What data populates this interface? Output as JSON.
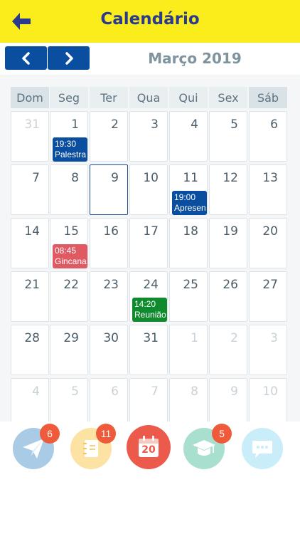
{
  "header": {
    "title": "Calendário"
  },
  "toolbar": {
    "month_label": "Março 2019"
  },
  "weekdays": [
    "Dom",
    "Seg",
    "Ter",
    "Qua",
    "Qui",
    "Sex",
    "Sáb"
  ],
  "weeks": [
    [
      {
        "day": "31",
        "other": true
      },
      {
        "day": "1"
      },
      {
        "day": "2"
      },
      {
        "day": "3"
      },
      {
        "day": "4"
      },
      {
        "day": "5"
      },
      {
        "day": "6"
      }
    ],
    [
      {
        "day": "7"
      },
      {
        "day": "8"
      },
      {
        "day": "9",
        "today": true
      },
      {
        "day": "10"
      },
      {
        "day": "11"
      },
      {
        "day": "12"
      },
      {
        "day": "13"
      }
    ],
    [
      {
        "day": "14"
      },
      {
        "day": "15"
      },
      {
        "day": "16"
      },
      {
        "day": "17"
      },
      {
        "day": "18"
      },
      {
        "day": "19"
      },
      {
        "day": "20"
      }
    ],
    [
      {
        "day": "21"
      },
      {
        "day": "22"
      },
      {
        "day": "23"
      },
      {
        "day": "24"
      },
      {
        "day": "25"
      },
      {
        "day": "26"
      },
      {
        "day": "27"
      }
    ],
    [
      {
        "day": "28"
      },
      {
        "day": "29"
      },
      {
        "day": "30"
      },
      {
        "day": "31"
      },
      {
        "day": "1",
        "other": true
      },
      {
        "day": "2",
        "other": true
      },
      {
        "day": "3",
        "other": true
      }
    ],
    [
      {
        "day": "4",
        "other": true
      },
      {
        "day": "5",
        "other": true
      },
      {
        "day": "6",
        "other": true
      },
      {
        "day": "7",
        "other": true
      },
      {
        "day": "8",
        "other": true
      },
      {
        "day": "9",
        "other": true
      },
      {
        "day": "10",
        "other": true
      }
    ]
  ],
  "events": [
    {
      "week": 0,
      "col": 1,
      "time": "19:30",
      "label": "Palestra",
      "color": "#0a4ea0"
    },
    {
      "week": 1,
      "col": 4,
      "time": "19:00",
      "label": "Apresen",
      "color": "#0a4ea0"
    },
    {
      "week": 2,
      "col": 1,
      "time": "08:45",
      "label": "Gincana",
      "color": "#e05a64"
    },
    {
      "week": 3,
      "col": 3,
      "time": "14:20",
      "label": "Reunião",
      "color": "#0f8a2c"
    }
  ],
  "tabs": [
    {
      "name": "messages-tab",
      "icon": "paper-plane-icon",
      "color": "#a9cbe6",
      "badge": "6"
    },
    {
      "name": "agenda-tab",
      "icon": "notebook-icon",
      "color": "#fde3a3",
      "badge": "11"
    },
    {
      "name": "calendar-tab",
      "icon": "calendar-icon",
      "color": "#ec5a4c",
      "badge": "",
      "icon_text": "20"
    },
    {
      "name": "school-tab",
      "icon": "graduation-cap-icon",
      "color": "#a9dfcf",
      "badge": "5"
    },
    {
      "name": "chat-tab",
      "icon": "chat-bubble-icon",
      "color": "#c9eef9",
      "badge": ""
    }
  ]
}
